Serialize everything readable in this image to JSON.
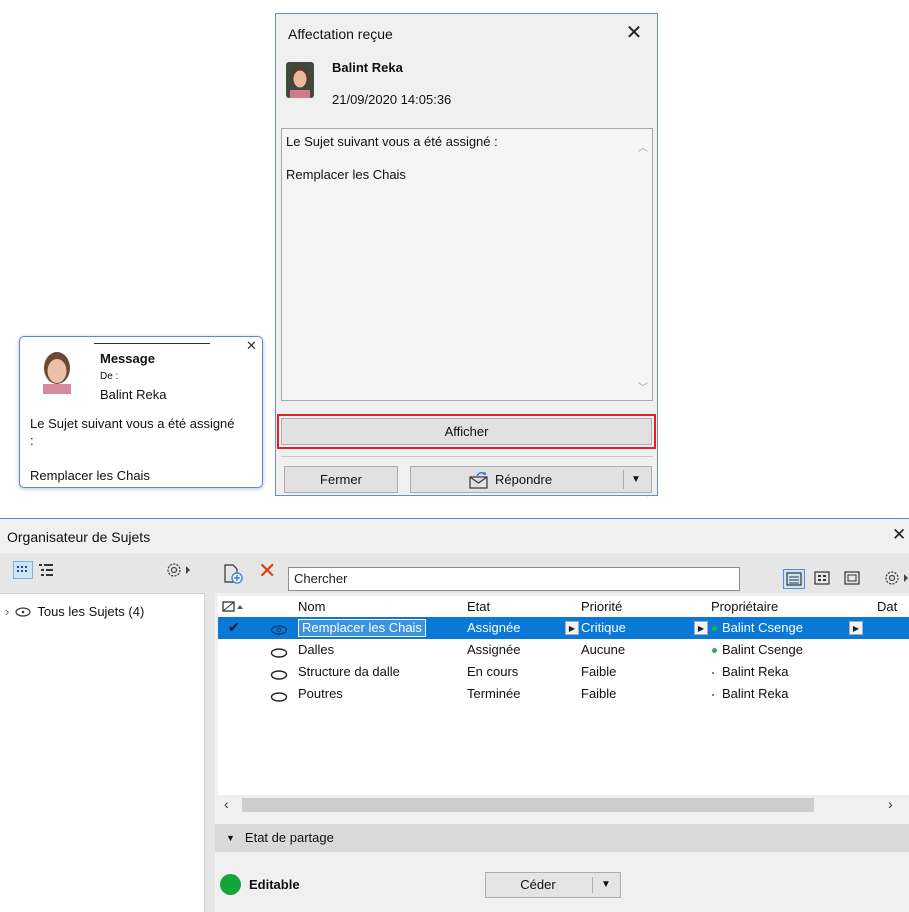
{
  "dialog": {
    "title": "Affectation reçue",
    "sender": "Balint Reka",
    "date": "21/09/2020 14:05:36",
    "message_line1": "Le Sujet suivant vous a été assigné :",
    "message_line2": "Remplacer les Chais",
    "show_button": "Afficher",
    "close_button": "Fermer",
    "reply_button": "Répondre",
    "highlight_color": "#e0202a"
  },
  "toast": {
    "title": "Message",
    "from_label": "De :",
    "from_name": "Balint Reka",
    "body_line1": "Le Sujet suivant vous a été assigné :",
    "body_line2": "Remplacer les Chais"
  },
  "organizer": {
    "title": "Organisateur de Sujets",
    "all_issues": "Tous les Sujets (4)",
    "search_placeholder": "Chercher",
    "columns": [
      "Nom",
      "Etat",
      "Priorité",
      "Propriétaire",
      "Dat"
    ],
    "rows": [
      {
        "name": "Remplacer les Chais",
        "status": "Assignée",
        "priority": "Critique",
        "owner": "Balint Csenge"
      },
      {
        "name": "Dalles",
        "status": "Assignée",
        "priority": "Aucune",
        "owner": "Balint Csenge"
      },
      {
        "name": "Structure da dalle",
        "status": "En cours",
        "priority": "Faible",
        "owner": "Balint Reka"
      },
      {
        "name": "Poutres",
        "status": "Terminée",
        "priority": "Faible",
        "owner": "Balint Reka"
      }
    ],
    "sharing_header": "Etat de partage",
    "sharing_status": "Editable",
    "release_button": "Céder",
    "selection_color": "#0a78d7",
    "status_green": "#13a53b"
  }
}
